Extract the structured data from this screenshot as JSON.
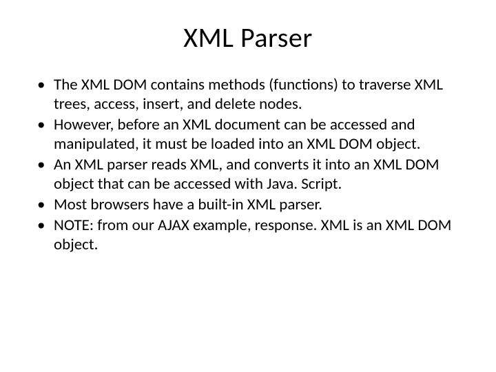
{
  "title": "XML Parser",
  "bullets": [
    "The XML DOM contains methods (functions) to traverse XML trees, access, insert, and delete nodes.",
    "However, before an XML document can be accessed and manipulated, it must be loaded into an XML DOM object.",
    "An XML parser reads XML, and converts it into an XML DOM object that can be accessed with Java. Script.",
    "Most browsers have a built-in XML parser.",
    "NOTE: from our AJAX example, response. XML is an XML DOM object."
  ]
}
